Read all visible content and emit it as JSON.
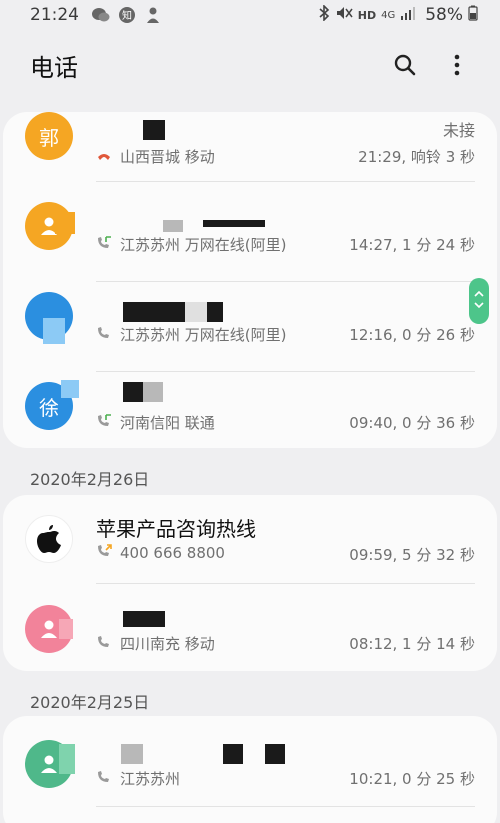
{
  "status": {
    "time": "21:24",
    "network": "4G",
    "hd": "HD",
    "battery": "58%"
  },
  "header": {
    "title": "电话",
    "search_icon": "search-icon",
    "more_icon": "more-vert-icon"
  },
  "groups": [
    {
      "date": "",
      "items": [
        {
          "avatar_text": "郭",
          "avatar_color": "#f5a623",
          "name": "",
          "location": "山西晋城 移动",
          "call_type": "missed",
          "missed_label": "未接",
          "meta": "21:29, 响铃 3 秒"
        },
        {
          "avatar_text": "",
          "avatar_color": "#f5a623",
          "name": "",
          "location": "江苏苏州 万网在线(阿里)",
          "call_type": "incoming",
          "meta": "14:27, 1 分 24 秒"
        },
        {
          "avatar_text": "",
          "avatar_color": "#2b8fe0",
          "name": "",
          "location": "江苏苏州 万网在线(阿里)",
          "call_type": "incoming",
          "meta": "12:16, 0 分 26 秒"
        },
        {
          "avatar_text": "徐",
          "avatar_color": "#2b8fe0",
          "name": "",
          "location": "河南信阳 联通",
          "call_type": "incoming",
          "meta": "09:40, 0 分 36 秒"
        }
      ]
    },
    {
      "date": "2020年2月26日",
      "items": [
        {
          "avatar_text": "",
          "avatar_color": "#ffffff",
          "name": "苹果产品咨询热线",
          "location": "400 666 8800",
          "call_type": "outgoing",
          "meta": "09:59, 5 分 32 秒"
        },
        {
          "avatar_text": "",
          "avatar_color": "#f2839a",
          "name": "",
          "location": "四川南充 移动",
          "call_type": "incoming",
          "meta": "08:12, 1 分 14 秒"
        }
      ]
    },
    {
      "date": "2020年2月25日",
      "items": [
        {
          "avatar_text": "",
          "avatar_color": "#4fb88a",
          "name": "",
          "location": "江苏苏州",
          "call_type": "incoming",
          "meta": "10:21, 0 分 25 秒"
        }
      ]
    }
  ]
}
